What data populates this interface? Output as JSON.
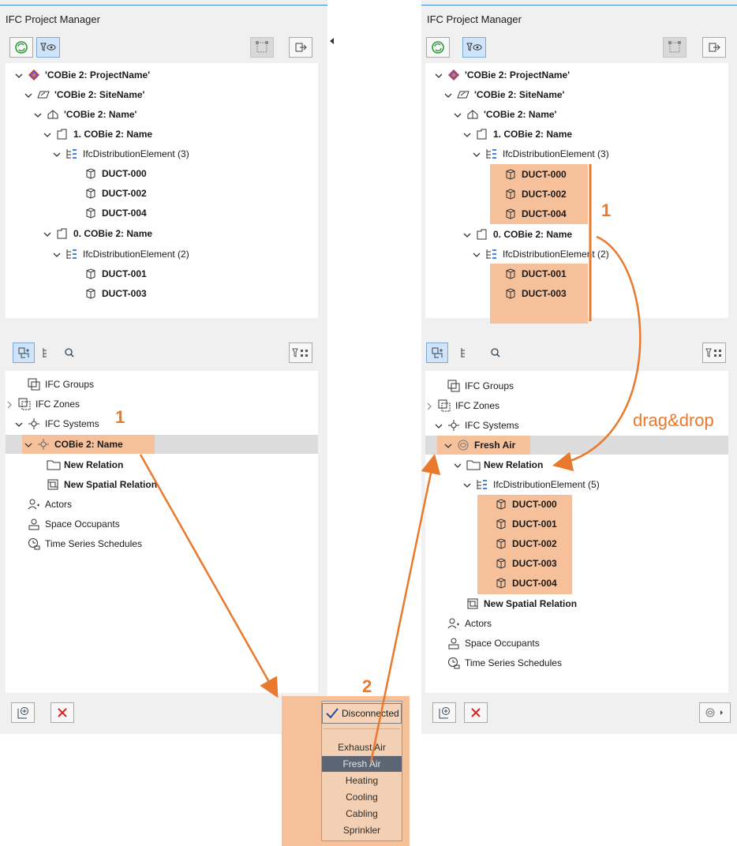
{
  "left": {
    "title": "IFC Project Manager",
    "tree": [
      {
        "label": "'COBie 2: ProjectName'",
        "bold": true,
        "icon": "project-icon",
        "chev": "down"
      },
      {
        "label": "'COBie 2: SiteName'",
        "bold": true,
        "icon": "site-icon",
        "chev": "down"
      },
      {
        "label": "'COBie 2: Name'",
        "bold": true,
        "icon": "building-icon",
        "chev": "down"
      },
      {
        "label": "1. COBie 2: Name",
        "bold": true,
        "icon": "storey-icon",
        "chev": "down"
      },
      {
        "label": "IfcDistributionElement (3)",
        "bold": false,
        "icon": "element-type-icon",
        "chev": "down"
      },
      {
        "label": "DUCT-000",
        "bold": true,
        "icon": "object-icon",
        "chev": ""
      },
      {
        "label": "DUCT-002",
        "bold": true,
        "icon": "object-icon",
        "chev": ""
      },
      {
        "label": "DUCT-004",
        "bold": true,
        "icon": "object-icon",
        "chev": ""
      },
      {
        "label": "0. COBie 2: Name",
        "bold": true,
        "icon": "storey-icon",
        "chev": "down"
      },
      {
        "label": "IfcDistributionElement (2)",
        "bold": false,
        "icon": "element-type-icon",
        "chev": "down"
      },
      {
        "label": "DUCT-001",
        "bold": true,
        "icon": "object-icon",
        "chev": ""
      },
      {
        "label": "DUCT-003",
        "bold": true,
        "icon": "object-icon",
        "chev": ""
      }
    ],
    "tree2": [
      {
        "label": "IFC Groups",
        "bold": false,
        "icon": "groups-icon",
        "chev": ""
      },
      {
        "label": "IFC Zones",
        "bold": false,
        "icon": "zones-icon",
        "chev": "right"
      },
      {
        "label": "IFC Systems",
        "bold": false,
        "icon": "systems-icon",
        "chev": "down"
      },
      {
        "label": "COBie 2: Name",
        "bold": true,
        "icon": "system-icon",
        "chev": "down"
      },
      {
        "label": "New Relation",
        "bold": true,
        "icon": "folder-icon",
        "chev": ""
      },
      {
        "label": "New Spatial Relation",
        "bold": true,
        "icon": "spatial-relation-icon",
        "chev": ""
      },
      {
        "label": "Actors",
        "bold": false,
        "icon": "actors-icon",
        "chev": ""
      },
      {
        "label": "Space Occupants",
        "bold": false,
        "icon": "occupants-icon",
        "chev": ""
      },
      {
        "label": "Time Series Schedules",
        "bold": false,
        "icon": "schedule-icon",
        "chev": ""
      }
    ]
  },
  "right": {
    "title": "IFC Project Manager",
    "tree": [
      {
        "label": "'COBie 2: ProjectName'",
        "bold": true,
        "icon": "project-icon",
        "chev": "down"
      },
      {
        "label": "'COBie 2: SiteName'",
        "bold": true,
        "icon": "site-icon",
        "chev": "down"
      },
      {
        "label": "'COBie 2: Name'",
        "bold": true,
        "icon": "building-icon",
        "chev": "down"
      },
      {
        "label": "1. COBie 2: Name",
        "bold": true,
        "icon": "storey-icon",
        "chev": "down"
      },
      {
        "label": "IfcDistributionElement (3)",
        "bold": false,
        "icon": "element-type-icon",
        "chev": "down"
      },
      {
        "label": "DUCT-000",
        "bold": true,
        "icon": "object-icon",
        "chev": ""
      },
      {
        "label": "DUCT-002",
        "bold": true,
        "icon": "object-icon",
        "chev": ""
      },
      {
        "label": "DUCT-004",
        "bold": true,
        "icon": "object-icon",
        "chev": ""
      },
      {
        "label": "0. COBie 2: Name",
        "bold": true,
        "icon": "storey-icon",
        "chev": "down"
      },
      {
        "label": "IfcDistributionElement (2)",
        "bold": false,
        "icon": "element-type-icon",
        "chev": "down"
      },
      {
        "label": "DUCT-001",
        "bold": true,
        "icon": "object-icon",
        "chev": ""
      },
      {
        "label": "DUCT-003",
        "bold": true,
        "icon": "object-icon",
        "chev": ""
      }
    ],
    "tree2": [
      {
        "label": "IFC Groups",
        "bold": false,
        "icon": "groups-icon",
        "chev": ""
      },
      {
        "label": "IFC Zones",
        "bold": false,
        "icon": "zones-icon",
        "chev": "right"
      },
      {
        "label": "IFC Systems",
        "bold": false,
        "icon": "systems-icon",
        "chev": "down"
      },
      {
        "label": "Fresh Air",
        "bold": true,
        "icon": "fresh-air-icon",
        "chev": "down"
      },
      {
        "label": "New Relation",
        "bold": true,
        "icon": "folder-icon",
        "chev": "down"
      },
      {
        "label": "IfcDistributionElement (5)",
        "bold": false,
        "icon": "element-type-icon",
        "chev": "down"
      },
      {
        "label": "DUCT-000",
        "bold": true,
        "icon": "object-icon",
        "chev": ""
      },
      {
        "label": "DUCT-001",
        "bold": true,
        "icon": "object-icon",
        "chev": ""
      },
      {
        "label": "DUCT-002",
        "bold": true,
        "icon": "object-icon",
        "chev": ""
      },
      {
        "label": "DUCT-003",
        "bold": true,
        "icon": "object-icon",
        "chev": ""
      },
      {
        "label": "DUCT-004",
        "bold": true,
        "icon": "object-icon",
        "chev": ""
      },
      {
        "label": "New Spatial Relation",
        "bold": true,
        "icon": "spatial-relation-icon",
        "chev": ""
      },
      {
        "label": "Actors",
        "bold": false,
        "icon": "actors-icon",
        "chev": ""
      },
      {
        "label": "Space Occupants",
        "bold": false,
        "icon": "occupants-icon",
        "chev": ""
      },
      {
        "label": "Time Series Schedules",
        "bold": false,
        "icon": "schedule-icon",
        "chev": ""
      }
    ]
  },
  "menu": {
    "check_item": "Disconnected",
    "items": [
      "Exhaust Air",
      "Fresh Air",
      "Heating",
      "Cooling",
      "Cabling",
      "Sprinkler"
    ],
    "selected": "Fresh Air"
  },
  "annotations": {
    "step1": "1",
    "step2": "2",
    "step1_right": "1",
    "dragdrop": "drag&drop"
  },
  "colors": {
    "highlight": "#f6c09a",
    "arrow": "#e8792d",
    "accent": "#3a8ad8"
  }
}
